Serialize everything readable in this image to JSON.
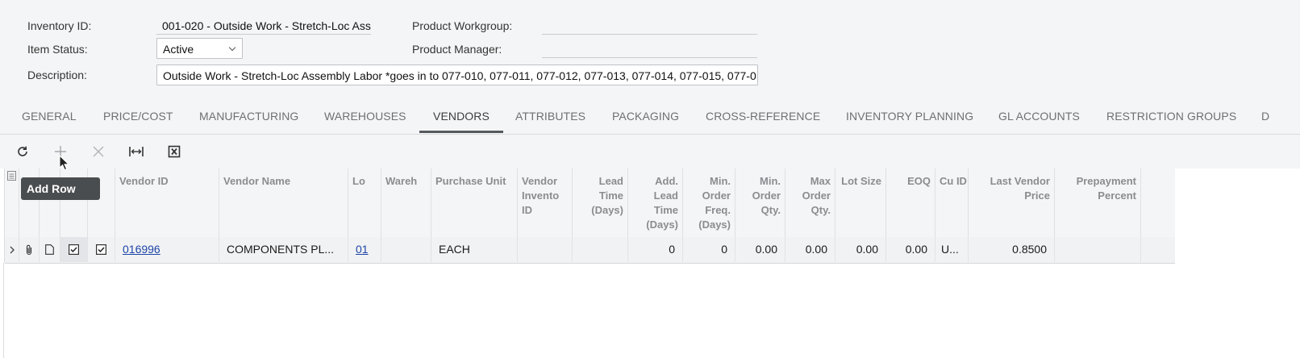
{
  "summary": {
    "inventory_id_label": "Inventory ID:",
    "inventory_id_value": "001-020 - Outside Work - Stretch-Loc Ass",
    "item_status_label": "Item Status:",
    "item_status_value": "Active",
    "description_label": "Description:",
    "description_value": "Outside Work - Stretch-Loc Assembly Labor *goes in to 077-010, 077-011, 077-012, 077-013, 077-014, 077-015, 077-0",
    "product_workgroup_label": "Product Workgroup:",
    "product_workgroup_value": "",
    "product_manager_label": "Product Manager:",
    "product_manager_value": ""
  },
  "tabs": [
    "GENERAL",
    "PRICE/COST",
    "MANUFACTURING",
    "WAREHOUSES",
    "VENDORS",
    "ATTRIBUTES",
    "PACKAGING",
    "CROSS-REFERENCE",
    "INVENTORY PLANNING",
    "GL ACCOUNTS",
    "RESTRICTION GROUPS",
    "D"
  ],
  "active_tab": "VENDORS",
  "toolbar": {
    "refresh_icon": "refresh-icon",
    "add_icon": "plus-icon",
    "delete_icon": "close-icon",
    "fit_icon": "fit-columns-icon",
    "export_icon": "excel-export-icon",
    "tooltip": "Add Row"
  },
  "grid": {
    "columns": {
      "c4": "Vendor ID",
      "c5": "Vendor Name",
      "c6": "Lo",
      "c7": "Wareh",
      "c8": "Purchase Unit",
      "c9": "Vendor Invento ID",
      "c10": "Lead Time (Days)",
      "c11": "Add. Lead Time (Days)",
      "c12": "Min. Order Freq. (Days)",
      "c13": "Min. Order Qty.",
      "c14": "Max Order Qty.",
      "c15": "Lot Size",
      "c16": "EOQ",
      "c17": "Cu ID",
      "c18": "Last Vendor Price",
      "c19": "Prepayment Percent"
    },
    "rows": [
      {
        "vendor_id": "016996",
        "vendor_name": "COMPONENTS PL...",
        "location": "01",
        "warehouse": "",
        "purchase_unit": "EACH",
        "vendor_inventory_id": "",
        "lead_time": "",
        "add_lead_time": "0",
        "min_order_freq": "0",
        "min_order_qty": "0.00",
        "max_order_qty": "0.00",
        "lot_size": "0.00",
        "eoq": "0.00",
        "currency": "U...",
        "last_vendor_price": "0.8500",
        "prepayment_percent": ""
      }
    ]
  },
  "colors": {
    "link": "#1d45a8",
    "active_tab_underline": "#55595d",
    "tooltip_bg": "#4a4d50"
  }
}
